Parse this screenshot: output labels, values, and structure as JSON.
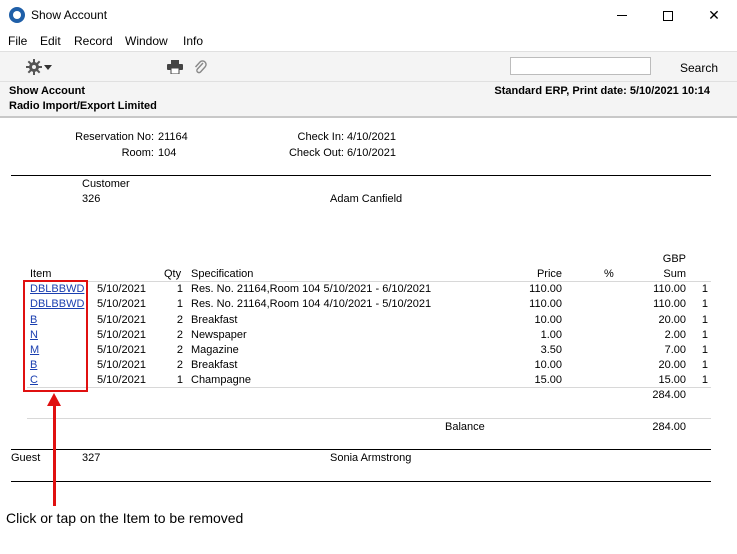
{
  "window": {
    "title": "Show Account"
  },
  "menu": [
    "File",
    "Edit",
    "Record",
    "Window",
    "Info"
  ],
  "toolbar": {
    "search_value": "",
    "search_label": "Search"
  },
  "report": {
    "title": "Show Account",
    "company": "Radio Import/Export Limited",
    "system_line": "Standard ERP, Print date: 5/10/2021 10:14"
  },
  "reservation": {
    "reservation_no_label": "Reservation No:",
    "reservation_no": "21164",
    "room_label": "Room:",
    "room": "104",
    "checkin_label": "Check In:",
    "checkin": "4/10/2021",
    "checkout_label": "Check Out:",
    "checkout": "6/10/2021"
  },
  "customer": {
    "label": "Customer",
    "code": "326",
    "name": "Adam Canfield"
  },
  "table": {
    "currency": "GBP",
    "headers": {
      "item": "Item",
      "qty": "Qty",
      "spec": "Specification",
      "price": "Price",
      "pct": "%",
      "sum": "Sum"
    },
    "rows": [
      {
        "item": "DBLBBWD",
        "date": "5/10/2021",
        "qty": "1",
        "spec": "Res. No. 21164,Room 104 5/10/2021 - 6/10/2021",
        "price": "110.00",
        "sum": "110.00",
        "n": "1"
      },
      {
        "item": "DBLBBWD",
        "date": "5/10/2021",
        "qty": "1",
        "spec": "Res. No. 21164,Room 104 4/10/2021 - 5/10/2021",
        "price": "110.00",
        "sum": "110.00",
        "n": "1"
      },
      {
        "item": "B",
        "date": "5/10/2021",
        "qty": "2",
        "spec": "Breakfast",
        "price": "10.00",
        "sum": "20.00",
        "n": "1"
      },
      {
        "item": "N",
        "date": "5/10/2021",
        "qty": "2",
        "spec": "Newspaper",
        "price": "1.00",
        "sum": "2.00",
        "n": "1"
      },
      {
        "item": "M",
        "date": "5/10/2021",
        "qty": "2",
        "spec": "Magazine",
        "price": "3.50",
        "sum": "7.00",
        "n": "1"
      },
      {
        "item": "B",
        "date": "5/10/2021",
        "qty": "2",
        "spec": "Breakfast",
        "price": "10.00",
        "sum": "20.00",
        "n": "1"
      },
      {
        "item": "C",
        "date": "5/10/2021",
        "qty": "1",
        "spec": "Champagne",
        "price": "15.00",
        "sum": "15.00",
        "n": "1"
      }
    ],
    "total": "284.00",
    "balance_label": "Balance",
    "balance": "284.00"
  },
  "guest": {
    "label": "Guest",
    "code": "327",
    "name": "Sonia Armstrong"
  },
  "annotation": {
    "caption": "Click or tap on the Item to be removed",
    "color": "#e01010"
  }
}
